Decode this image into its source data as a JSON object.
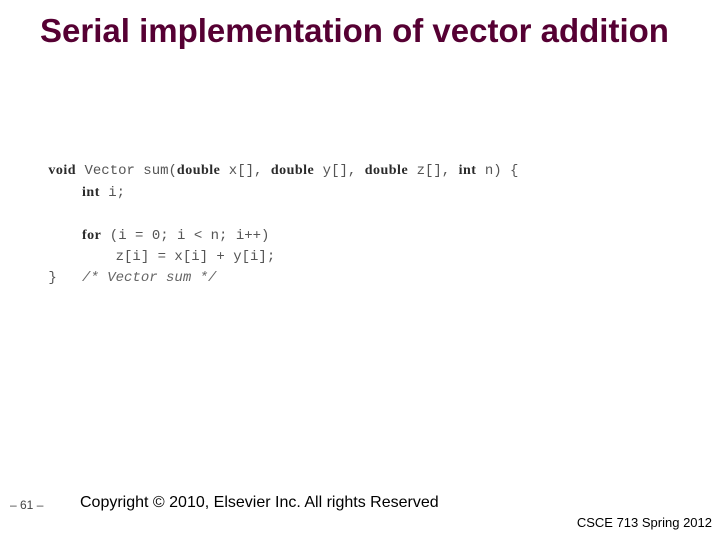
{
  "title": "Serial implementation of vector addition",
  "code": {
    "sig_pre": " ",
    "kw_void": "void",
    "sig_mid1": " Vector sum(",
    "kw_double1": "double",
    "sig_mid2": " x[], ",
    "kw_double2": "double",
    "sig_mid3": " y[], ",
    "kw_double3": "double",
    "sig_mid4": " z[], ",
    "kw_int1": "int",
    "sig_end": " n) {",
    "decl_indent": "     ",
    "kw_int2": "int",
    "decl_end": " i;",
    "blank": " ",
    "for_indent": "     ",
    "kw_for": "for",
    "for_cond": " (i = 0; i < n; i++)",
    "body": "         z[i] = x[i] + y[i];",
    "close_brace": " }   ",
    "comment": "/* Vector sum */"
  },
  "page_number": "– 61 –",
  "copyright": "Copyright © 2010, Elsevier Inc. All rights Reserved",
  "course": "CSCE 713 Spring 2012"
}
